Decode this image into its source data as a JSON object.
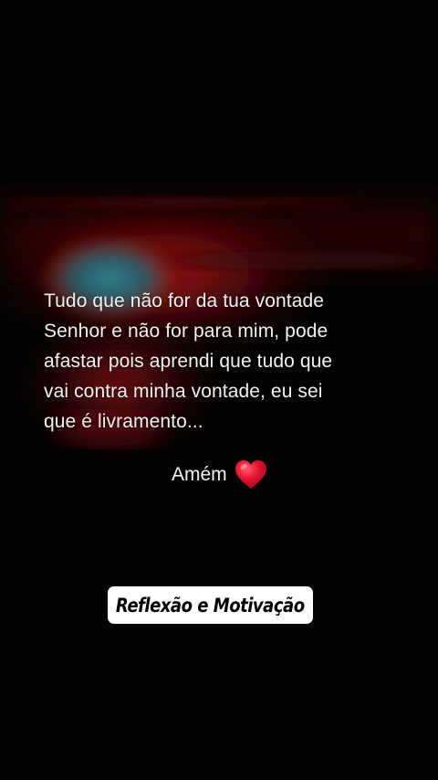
{
  "post": {
    "quote_lines": [
      "Tudo que não for da tua vontade",
      "Senhor e não for para mim, pode",
      "afastar pois aprendi que tudo que",
      "vai contra minha vontade, eu sei",
      "que é livramento..."
    ],
    "amen": "Amém",
    "amen_icon": "heart-icon",
    "badge": "Reflexão e Motivação"
  },
  "colors": {
    "background": "#030303",
    "sunset_red": "#c0161b",
    "sun_teal": "#2f8c98",
    "text": "#f2f2f2",
    "badge_bg": "#ffffff",
    "badge_text": "#000000",
    "heart": "#e3122f"
  }
}
